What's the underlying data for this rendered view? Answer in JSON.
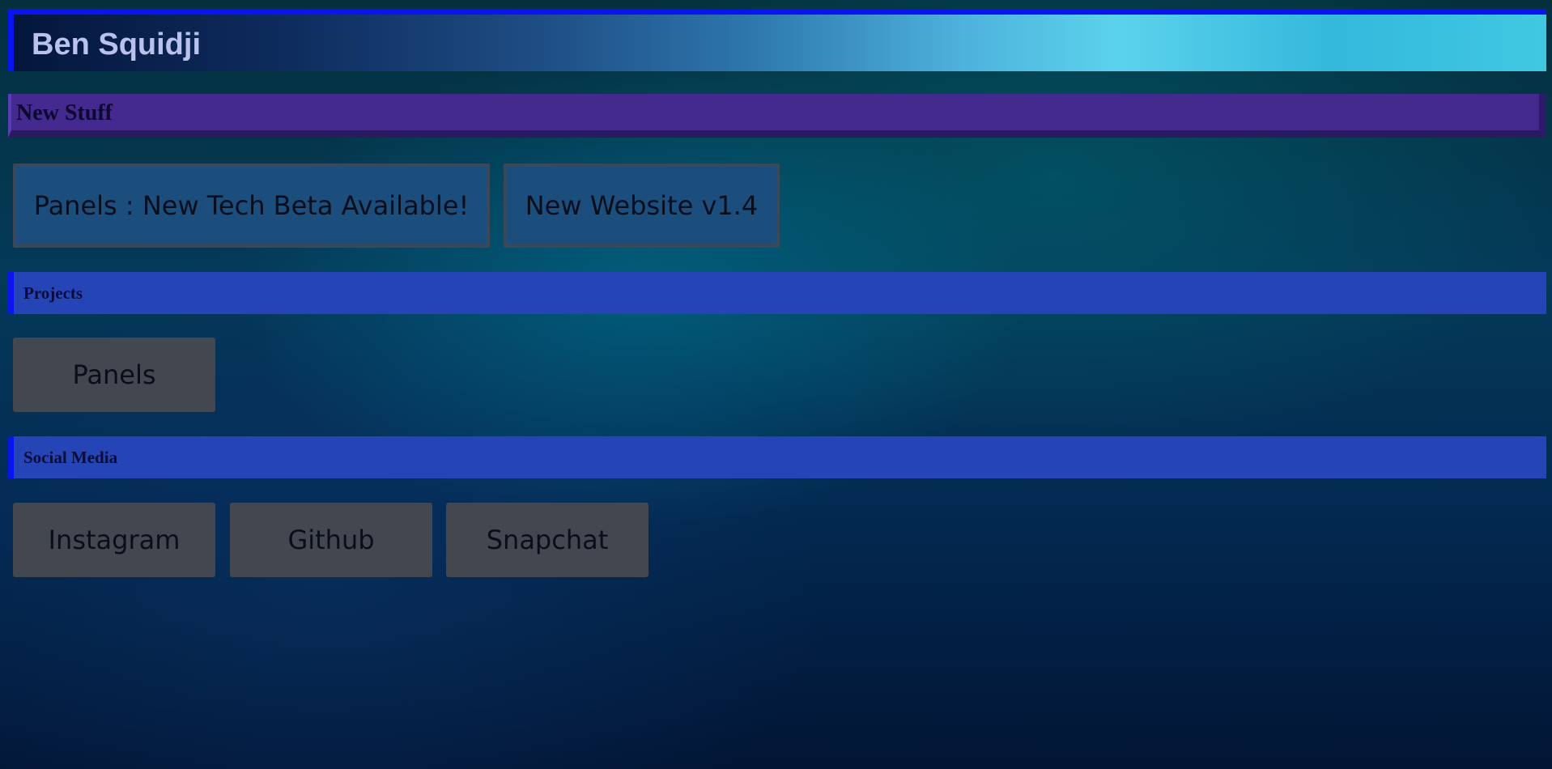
{
  "header": {
    "title": "Ben Squidji"
  },
  "sections": {
    "new_stuff": {
      "title": "New Stuff",
      "items": [
        {
          "label": "Panels : New Tech Beta Available!"
        },
        {
          "label": "New Website v1.4"
        }
      ]
    },
    "projects": {
      "title": "Projects",
      "items": [
        {
          "label": "Panels"
        }
      ]
    },
    "social_media": {
      "title": "Social Media",
      "items": [
        {
          "label": "Instagram"
        },
        {
          "label": "Github"
        },
        {
          "label": "Snapchat"
        }
      ]
    }
  },
  "colors": {
    "header_border": "#0a14f0",
    "new_stuff_bar": "#442a8e",
    "section_bar": "#2545b6",
    "news_tile": "#1b4e7c",
    "link_tile": "#424750"
  }
}
